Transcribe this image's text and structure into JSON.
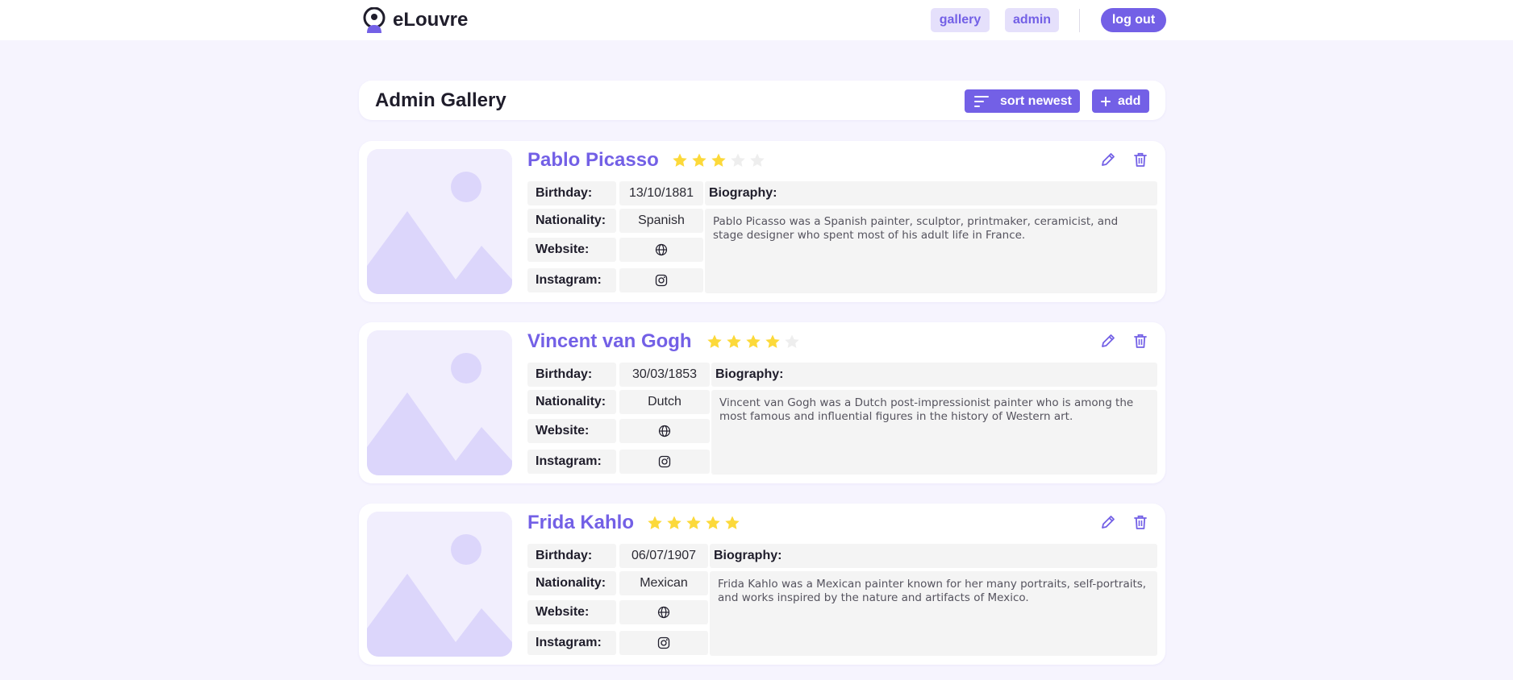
{
  "app": {
    "brand_name": "eLouvre",
    "nav": {
      "gallery_label": "gallery",
      "admin_label": "admin",
      "logout_label": "log out"
    },
    "accent_color": "#7360e6",
    "star_color": "#fcd93a"
  },
  "header": {
    "title": "Admin Gallery",
    "sort_label": "sort newest",
    "add_label": "add"
  },
  "field_labels": {
    "birthday": "Birthday:",
    "nationality": "Nationality:",
    "website": "Website:",
    "instagram": "Instagram:",
    "biography": "Biography:"
  },
  "artists": [
    {
      "name": "Pablo Picasso",
      "rating": 3,
      "birthday": "13/10/1881",
      "nationality": "Spanish",
      "biography": "Pablo Picasso was a Spanish painter, sculptor, printmaker, ceramicist, and stage designer who spent most of his adult life in France."
    },
    {
      "name": "Vincent van Gogh",
      "rating": 4,
      "birthday": "30/03/1853",
      "nationality": "Dutch",
      "biography": "Vincent van Gogh was a Dutch post-impressionist painter who is among the most famous and influential figures in the history of Western art."
    },
    {
      "name": "Frida Kahlo",
      "rating": 5,
      "birthday": "06/07/1907",
      "nationality": "Mexican",
      "biography": "Frida Kahlo was a Mexican painter known for her many portraits, self-portraits, and works inspired by the nature and artifacts of Mexico."
    }
  ]
}
